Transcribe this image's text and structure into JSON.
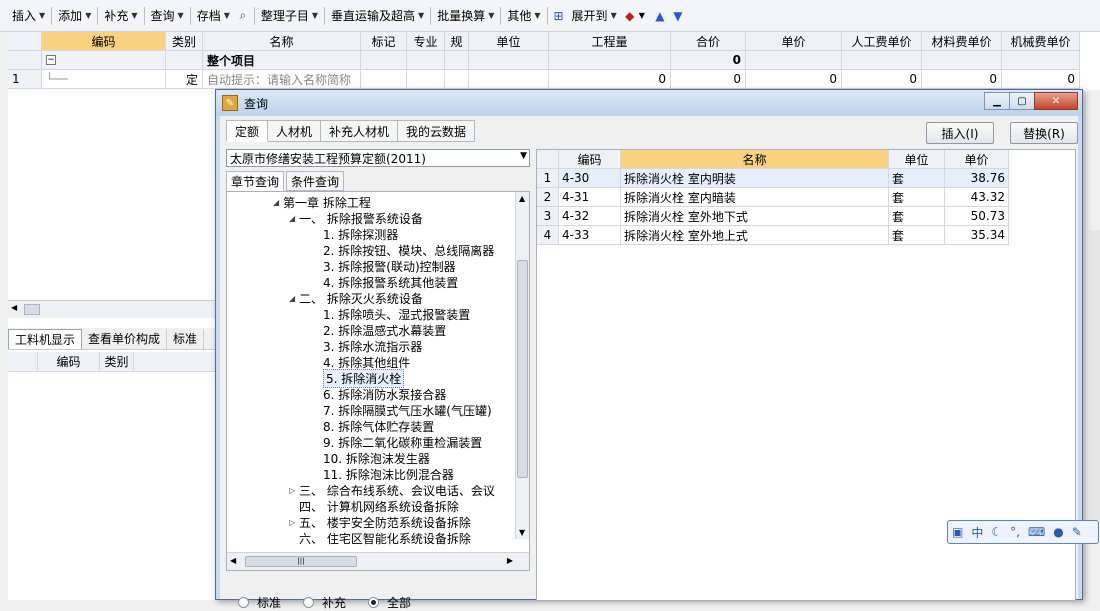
{
  "toolbar": {
    "items": [
      {
        "label": "插入",
        "dropdown": true
      },
      {
        "label": "添加",
        "dropdown": true
      },
      {
        "label": "补充",
        "dropdown": true
      },
      {
        "label": "查询",
        "dropdown": true
      },
      {
        "label": "存档",
        "dropdown": true
      },
      {
        "label": "整理子目",
        "dropdown": true
      },
      {
        "label": "垂直运输及超高",
        "dropdown": true
      },
      {
        "label": "批量换算",
        "dropdown": true
      },
      {
        "label": "其他",
        "dropdown": true
      },
      {
        "label": "展开到",
        "dropdown": true
      }
    ]
  },
  "main_grid": {
    "headers": [
      "编码",
      "类别",
      "名称",
      "标记",
      "专业",
      "规",
      "单位",
      "工程量",
      "合价",
      "单价",
      "人工费单价",
      "材料费单价",
      "机械费单价"
    ],
    "group_row": {
      "collapse": "−",
      "name": "整个项目",
      "total": "0"
    },
    "row1": {
      "index": "1",
      "type": "定",
      "name": "自动提示：请输入名称简称",
      "qty": "0",
      "total": "0",
      "unit_price": "0",
      "labor": "0",
      "material": "0",
      "machine": "0"
    }
  },
  "lower_tabs": [
    "工料机显示",
    "查看单价构成",
    "标准"
  ],
  "lower_headers": [
    "编码",
    "类别"
  ],
  "dialog": {
    "title": "查询",
    "tabs": [
      "定额",
      "人材机",
      "补充人材机",
      "我的云数据"
    ],
    "insert_button": "插入(I)",
    "replace_button": "替换(R)",
    "library": "太原市修缮安装工程预算定额(2011)",
    "subtabs": [
      "章节查询",
      "条件查询"
    ],
    "tree": [
      {
        "text": "第一章  拆除工程",
        "toggle": "◢"
      },
      {
        "text": "一、  拆除报警系统设备",
        "toggle": "◢"
      },
      {
        "text": "1.  拆除探测器",
        "toggle": ""
      },
      {
        "text": "2.  拆除按钮、模块、总线隔离器",
        "toggle": ""
      },
      {
        "text": "3.  拆除报警(联动)控制器",
        "toggle": ""
      },
      {
        "text": "4.  拆除报警系统其他装置",
        "toggle": ""
      },
      {
        "text": "二、  拆除灭火系统设备",
        "toggle": "◢"
      },
      {
        "text": "1.  拆除喷头、湿式报警装置",
        "toggle": ""
      },
      {
        "text": "2.  拆除温感式水幕装置",
        "toggle": ""
      },
      {
        "text": "3.  拆除水流指示器",
        "toggle": ""
      },
      {
        "text": "4.  拆除其他组件",
        "toggle": ""
      },
      {
        "text": "5.  拆除消火栓",
        "toggle": ""
      },
      {
        "text": "6.  拆除消防水泵接合器",
        "toggle": ""
      },
      {
        "text": "7.  拆除隔膜式气压水罐(气压罐)",
        "toggle": ""
      },
      {
        "text": "8.  拆除气体贮存装置",
        "toggle": ""
      },
      {
        "text": "9.  拆除二氧化碳称重检漏装置",
        "toggle": ""
      },
      {
        "text": "10.  拆除泡沫发生器",
        "toggle": ""
      },
      {
        "text": "11.  拆除泡沫比例混合器",
        "toggle": ""
      },
      {
        "text": "三、  综合布线系统、会议电话、会议",
        "toggle": "▷"
      },
      {
        "text": "四、  计算机网络系统设备拆除",
        "toggle": ""
      },
      {
        "text": "五、  楼宇安全防范系统设备拆除",
        "toggle": "▷"
      },
      {
        "text": "六、  住宅区智能化系统设备拆除",
        "toggle": ""
      }
    ],
    "radios": [
      {
        "label": "标准",
        "checked": false
      },
      {
        "label": "补充",
        "checked": false
      },
      {
        "label": "全部",
        "checked": true
      }
    ],
    "results": {
      "headers": [
        "编码",
        "名称",
        "单位",
        "单价"
      ],
      "rows": [
        {
          "index": "1",
          "code": "4-30",
          "name": "拆除消火栓 室内明装",
          "unit": "套",
          "price": "38.76"
        },
        {
          "index": "2",
          "code": "4-31",
          "name": "拆除消火栓 室内暗装",
          "unit": "套",
          "price": "43.32"
        },
        {
          "index": "3",
          "code": "4-32",
          "name": "拆除消火栓 室外地下式",
          "unit": "套",
          "price": "50.73"
        },
        {
          "index": "4",
          "code": "4-33",
          "name": "拆除消火栓 室外地上式",
          "unit": "套",
          "price": "35.34"
        }
      ]
    }
  },
  "ime_bar": {
    "lang": "中"
  },
  "colors": {
    "header_selected": "#f9d27f",
    "dialog_frame": "#c9daf0",
    "selected_row": "#e6eefb"
  }
}
